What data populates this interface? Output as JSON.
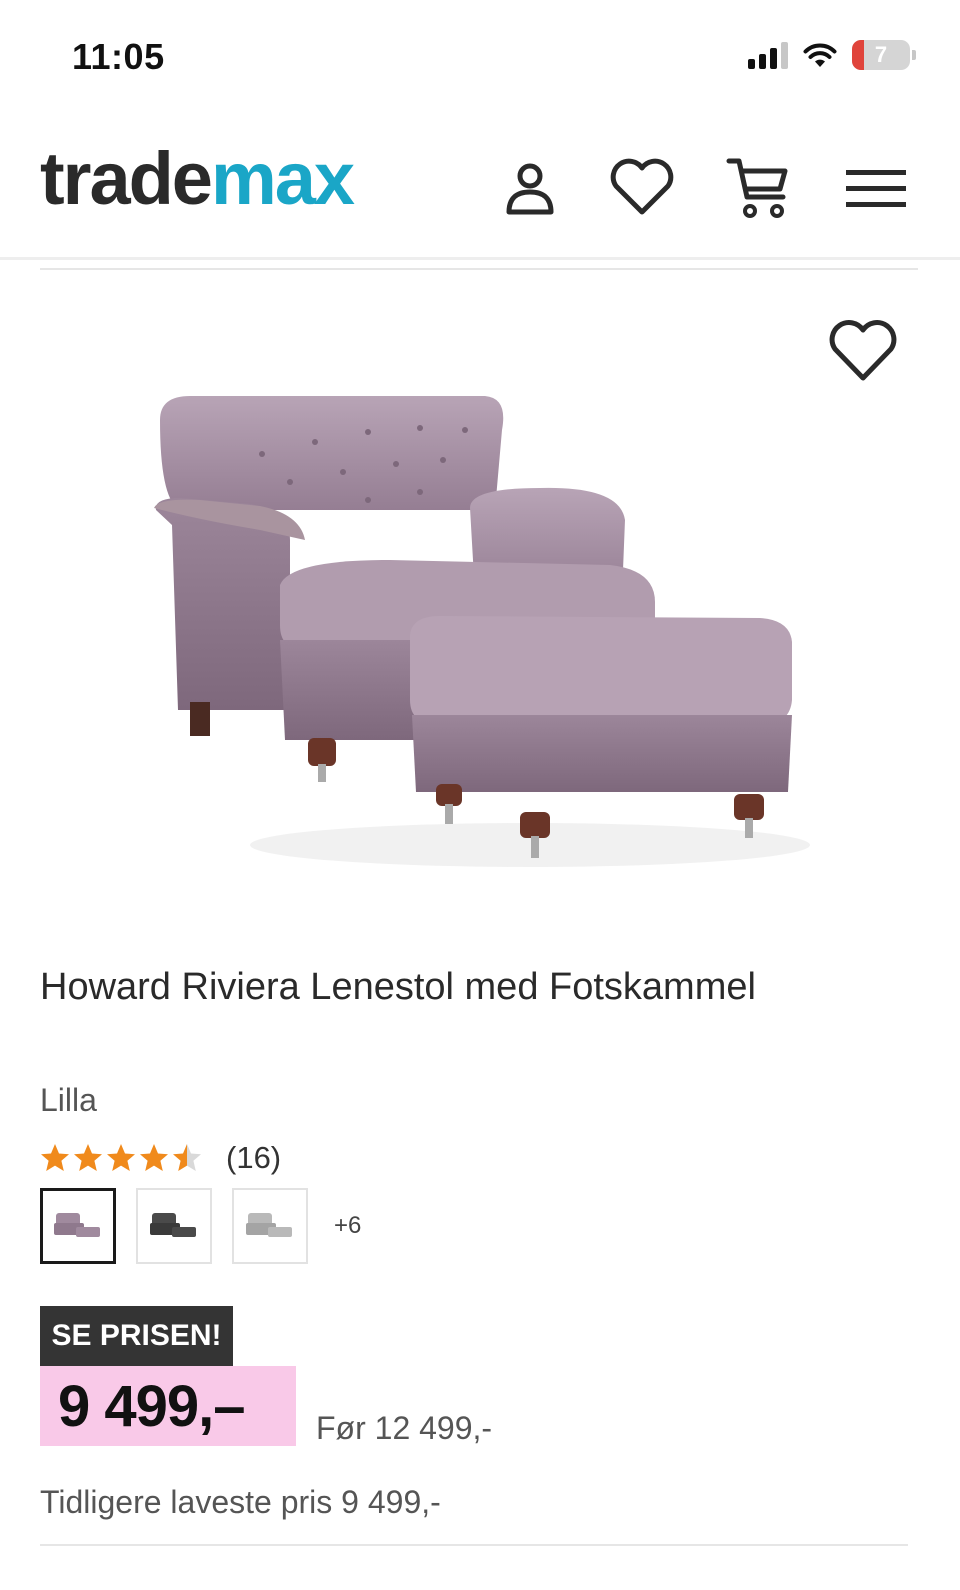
{
  "status_bar": {
    "time": "11:05",
    "battery_level": "7"
  },
  "header": {
    "logo_part1": "trade",
    "logo_part2": "max",
    "icons": [
      "user-icon",
      "heart-icon",
      "cart-icon",
      "menu-icon"
    ]
  },
  "product": {
    "title": "Howard Riviera Lenestol med Fotskammel",
    "variant": "Lilla",
    "rating": {
      "stars": 4.5,
      "max_stars": 5,
      "count": "(16)"
    },
    "swatches": {
      "colors": [
        "#a08a9e",
        "#4a4a4a",
        "#b9b9b9"
      ],
      "more_label": "+6"
    },
    "badge": "SE PRISEN!",
    "price": "9 499,–",
    "old_price": "Før 12 499,-",
    "lowest_price": "Tidligere laveste pris 9 499,-"
  },
  "colors": {
    "brand_dark": "#2a2a2a",
    "brand_accent": "#1aa6c7",
    "price_highlight": "#f9c9e8",
    "star": "#f08a1c"
  }
}
